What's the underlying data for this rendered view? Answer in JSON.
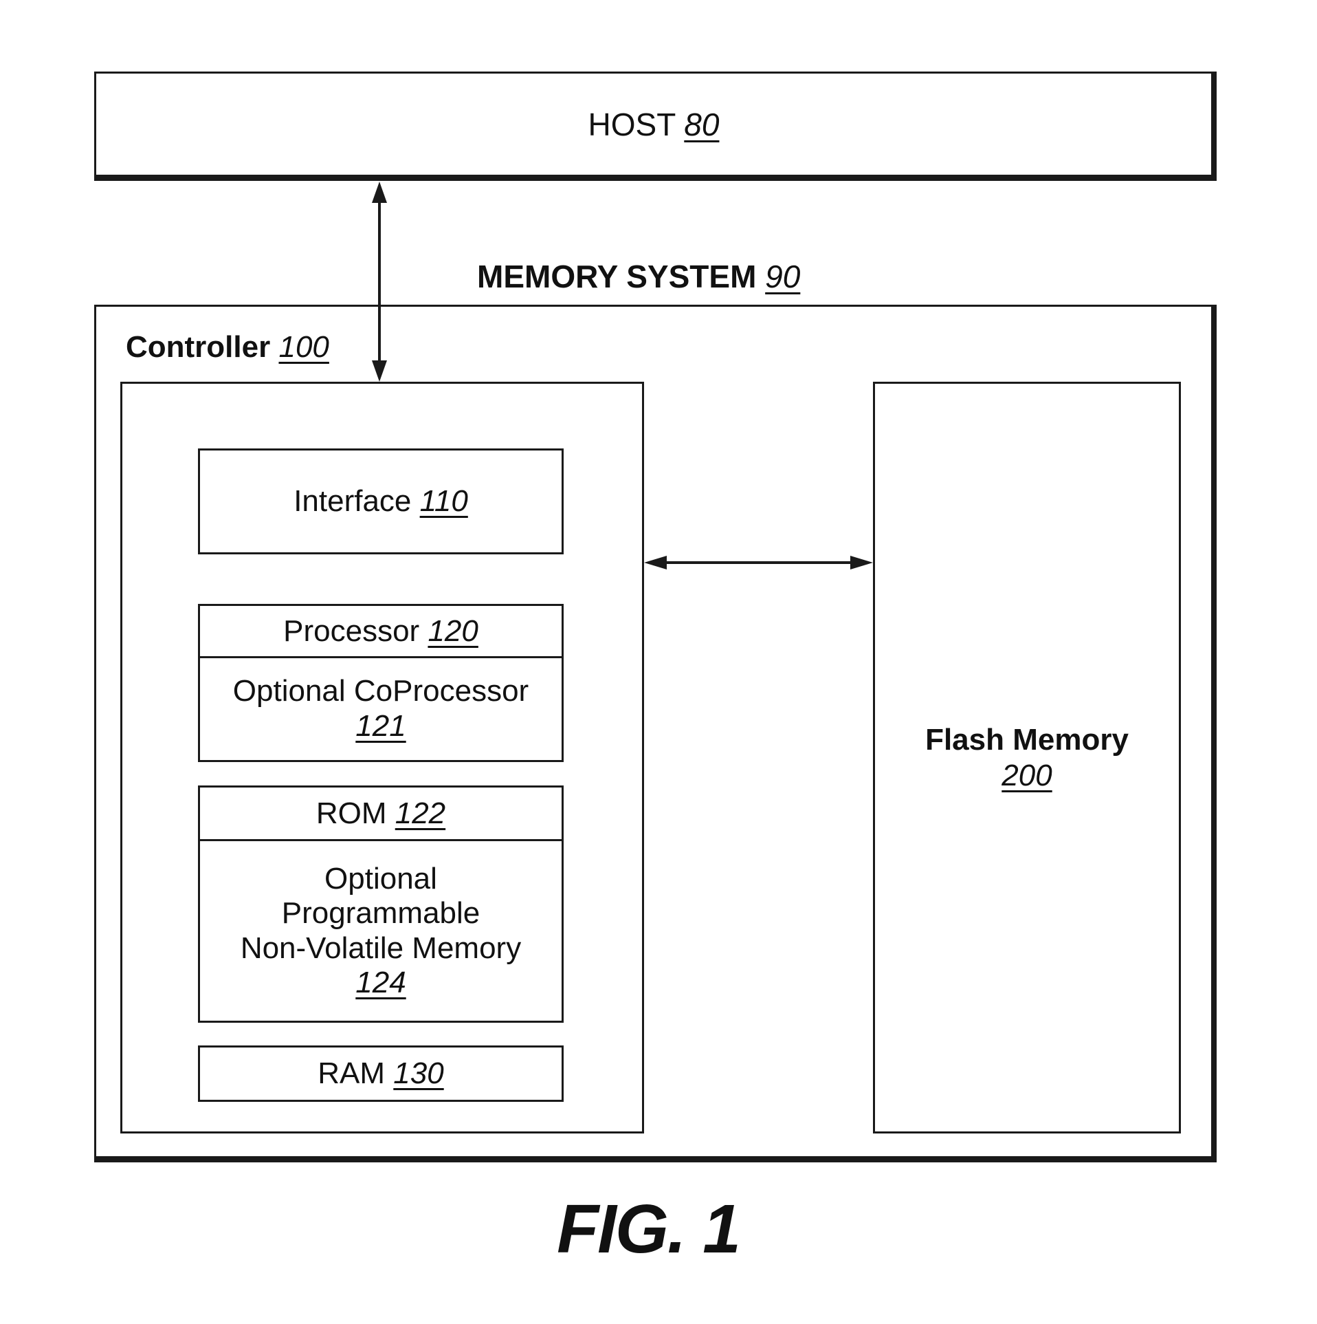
{
  "figure_caption": "FIG. 1",
  "host": {
    "name": "HOST",
    "ref": "80"
  },
  "memory_system": {
    "name": "MEMORY SYSTEM",
    "ref": "90"
  },
  "controller": {
    "name": "Controller",
    "ref": "100",
    "components": {
      "interface": {
        "name": "Interface",
        "ref": "110"
      },
      "processor": {
        "name": "Processor",
        "ref": "120"
      },
      "coprocessor": {
        "name": "Optional CoProcessor",
        "ref": "121"
      },
      "rom": {
        "name": "ROM",
        "ref": "122"
      },
      "pnvm": {
        "line1": "Optional",
        "line2": "Programmable",
        "line3": "Non-Volatile Memory",
        "ref": "124"
      },
      "ram": {
        "name": "RAM",
        "ref": "130"
      }
    }
  },
  "flash_memory": {
    "name": "Flash Memory",
    "ref": "200"
  },
  "connections": [
    {
      "from": "host",
      "to": "controller",
      "type": "bidirectional"
    },
    {
      "from": "controller",
      "to": "flash_memory",
      "type": "bidirectional"
    }
  ]
}
